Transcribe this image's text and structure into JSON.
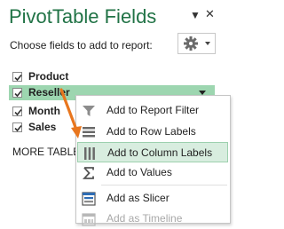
{
  "panel": {
    "title": "PivotTable Fields",
    "subtitle": "Choose fields to add to report:",
    "more_tables": "MORE TABLE"
  },
  "title_controls": {
    "dropdown_icon": "chevron-down-icon",
    "close_icon": "close-icon"
  },
  "tools_button": {
    "icon": "gear-icon"
  },
  "fields": [
    {
      "label": "Product",
      "checked": true
    },
    {
      "label": "Reseller",
      "checked": true,
      "selected": true
    },
    {
      "label": "Month",
      "checked": true
    },
    {
      "label": "Sales",
      "checked": true
    }
  ],
  "context_menu": {
    "items": [
      {
        "label": "Add to Report Filter",
        "icon": "filter-icon"
      },
      {
        "label": "Add to Row Labels",
        "icon": "rows-icon"
      },
      {
        "label": "Add to Column Labels",
        "icon": "columns-icon",
        "highlighted": true
      },
      {
        "label": "Add to Values",
        "icon": "sigma-icon"
      },
      {
        "label": "Add as Slicer",
        "icon": "slicer-icon"
      },
      {
        "label": "Add as Timeline",
        "icon": "timeline-icon",
        "disabled": true
      }
    ]
  },
  "colors": {
    "title": "#217346",
    "selected_row": "#9dd6b0",
    "highlight": "#d8eddf",
    "cursor_arrow": "#e8761e"
  }
}
